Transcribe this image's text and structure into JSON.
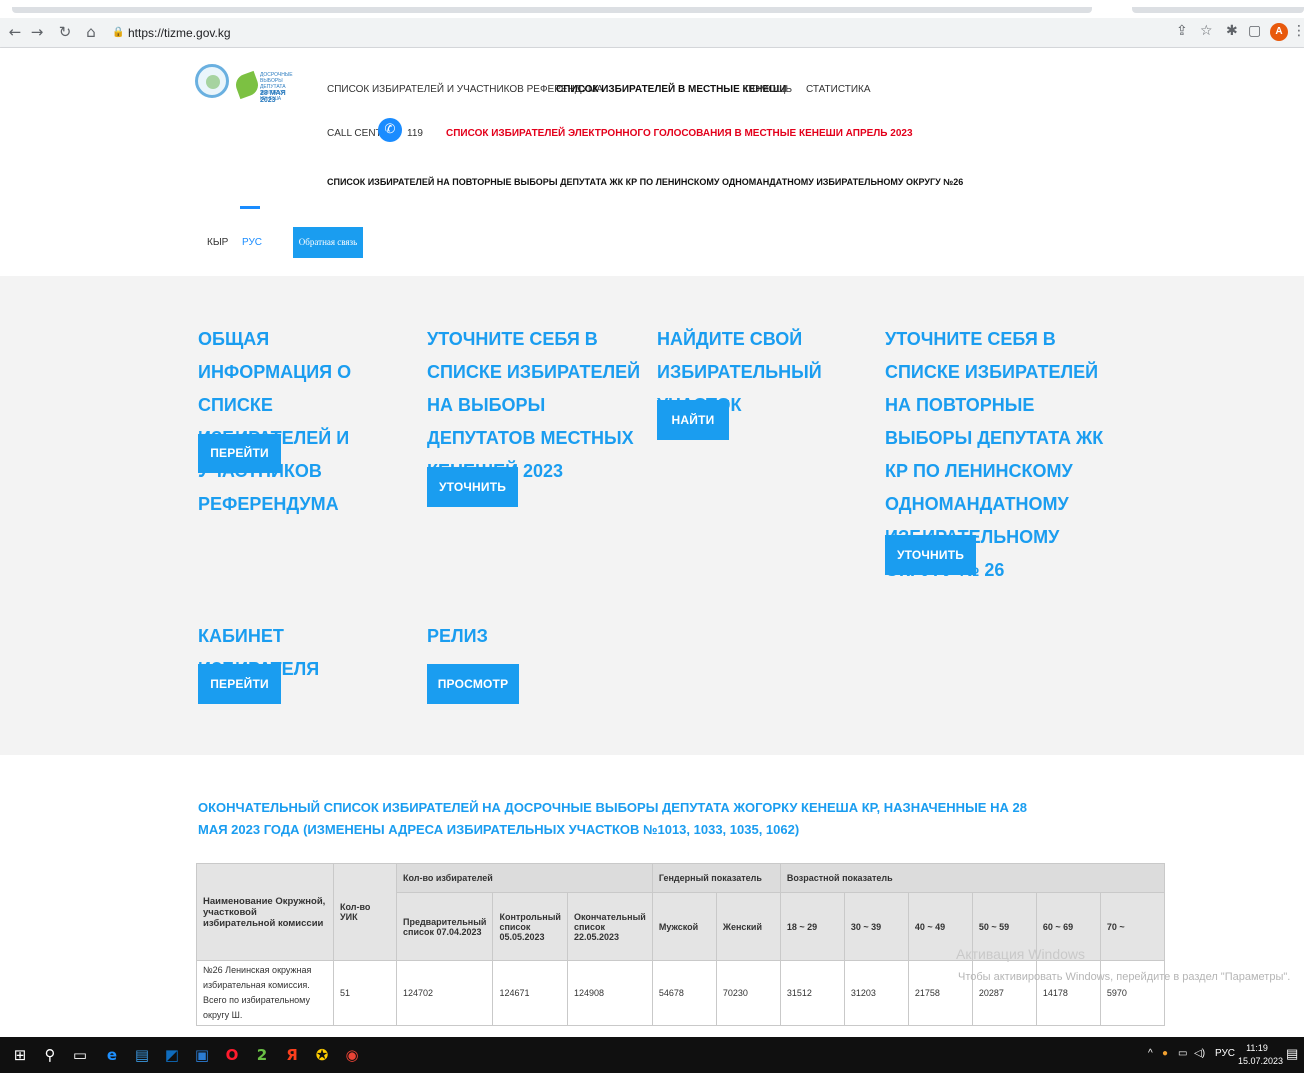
{
  "browser": {
    "url": "https://tizme.gov.kg",
    "back_icon": "arrow-left-icon",
    "forward_icon": "arrow-right-icon",
    "reload_icon": "reload-icon",
    "home_icon": "home-icon",
    "avatar_letter": "A"
  },
  "header": {
    "logo_text": "ДОСРОЧНЫЕ ВЫБОРЫ ДЕПУТАТА ЖОГОРКУ КЕНЕША",
    "logo_date": "28 МАЯ 2023",
    "nav": {
      "item1": "СПИСОК ИЗБИРАТЕЛЕЙ И УЧАСТНИКОВ РЕФЕРЕНДУМА",
      "item2": "СПИСОК ИЗБИРАТЕЛЕЙ В МЕСТНЫЕ КЕНЕШИ",
      "item3": "ПОМОЩЬ",
      "item4": "СТАТИСТИКА",
      "call_center": "CALL CENTER",
      "call_number": "119",
      "electronic": "СПИСОК ИЗБИРАТЕЛЕЙ ЭЛЕКТРОННОГО ГОЛОСОВАНИЯ В МЕСТНЫЕ КЕНЕШИ АПРЕЛЬ 2023",
      "repeat": "СПИСОК ИЗБИРАТЕЛЕЙ НА ПОВТОРНЫЕ ВЫБОРЫ ДЕПУТАТА ЖК КР ПО ЛЕНИНСКОМУ ОДНОМАНДАТНОМУ ИЗБИРАТЕЛЬНОМУ ОКРУГУ №26"
    },
    "lang_kyr": "КЫР",
    "lang_rus": "РУС",
    "feedback": "Обратная связь"
  },
  "cards": [
    {
      "title": "ОБЩАЯ ИНФОРМАЦИЯ О СПИСКЕ ИЗБИРАТЕЛЕЙ И УЧАСТНИКОВ РЕФЕРЕНДУМА",
      "button": "ПЕРЕЙТИ"
    },
    {
      "title": "УТОЧНИТЕ СЕБЯ В СПИСКЕ ИЗБИРАТЕЛЕЙ НА ВЫБОРЫ ДЕПУТАТОВ МЕСТНЫХ КЕНЕШЕЙ 2023",
      "button": "УТОЧНИТЬ"
    },
    {
      "title": "НАЙДИТЕ СВОЙ ИЗБИРАТЕЛЬНЫЙ УЧАСТОК",
      "button": "НАЙТИ"
    },
    {
      "title": "УТОЧНИТЕ СЕБЯ В СПИСКЕ ИЗБИРАТЕЛЕЙ НА ПОВТОРНЫЕ ВЫБОРЫ ДЕПУТАТА ЖК КР ПО ЛЕНИНСКОМУ ОДНОМАНДАТНОМУ ИЗБИРАТЕЛЬНОМУ ОКРУГУ № 26",
      "button": "УТОЧНИТЬ"
    },
    {
      "title": "КАБИНЕТ ИЗБИРАТЕЛЯ",
      "button": "ПЕРЕЙТИ"
    },
    {
      "title": "РЕЛИЗ",
      "button": "ПРОСМОТР"
    }
  ],
  "section_title": "ОКОНЧАТЕЛЬНЫЙ СПИСОК ИЗБИРАТЕЛЕЙ НА ДОСРОЧНЫЕ ВЫБОРЫ ДЕПУТАТА ЖОГОРКУ КЕНЕША КР, НАЗНАЧЕННЫЕ НА 28 МАЯ 2023 ГОДА (ИЗМЕНЕНЫ АДРЕСА ИЗБИРАТЕЛЬНЫХ УЧАСТКОВ №1013, 1033, 1035, 1062)",
  "table": {
    "h_name": "Наименование Окружной, участковой избирательной комиссии",
    "h_uik": "Кол-во УИК",
    "h_voters": "Кол-во избирателей",
    "h_gender": "Гендерный показатель",
    "h_age": "Возрастной показатель",
    "h_prelim": "Предварительный список 07.04.2023",
    "h_control": "Контрольный список 05.05.2023",
    "h_final": "Окончательный список 22.05.2023",
    "h_male": "Мужской",
    "h_female": "Женский",
    "h_a1": "18 ~ 29",
    "h_a2": "30 ~ 39",
    "h_a3": "40 ~ 49",
    "h_a4": "50 ~ 59",
    "h_a5": "60 ~ 69",
    "h_a6": "70 ~",
    "row": {
      "name": "№26 Ленинская окружная избирательная комиссия. Всего по избирательному округу Ш.",
      "uik": "51",
      "prelim": "124702",
      "control": "124671",
      "final": "124908",
      "male": "54678",
      "female": "70230",
      "a1": "31512",
      "a2": "31203",
      "a3": "21758",
      "a4": "20287",
      "a5": "14178",
      "a6": "5970"
    }
  },
  "watermark": {
    "line1": "Активация Windows",
    "line2": "Чтобы активировать Windows, перейдите в раздел \"Параметры\"."
  },
  "taskbar": {
    "lang": "РУС",
    "time": "11:19",
    "date": "15.07.2023"
  }
}
